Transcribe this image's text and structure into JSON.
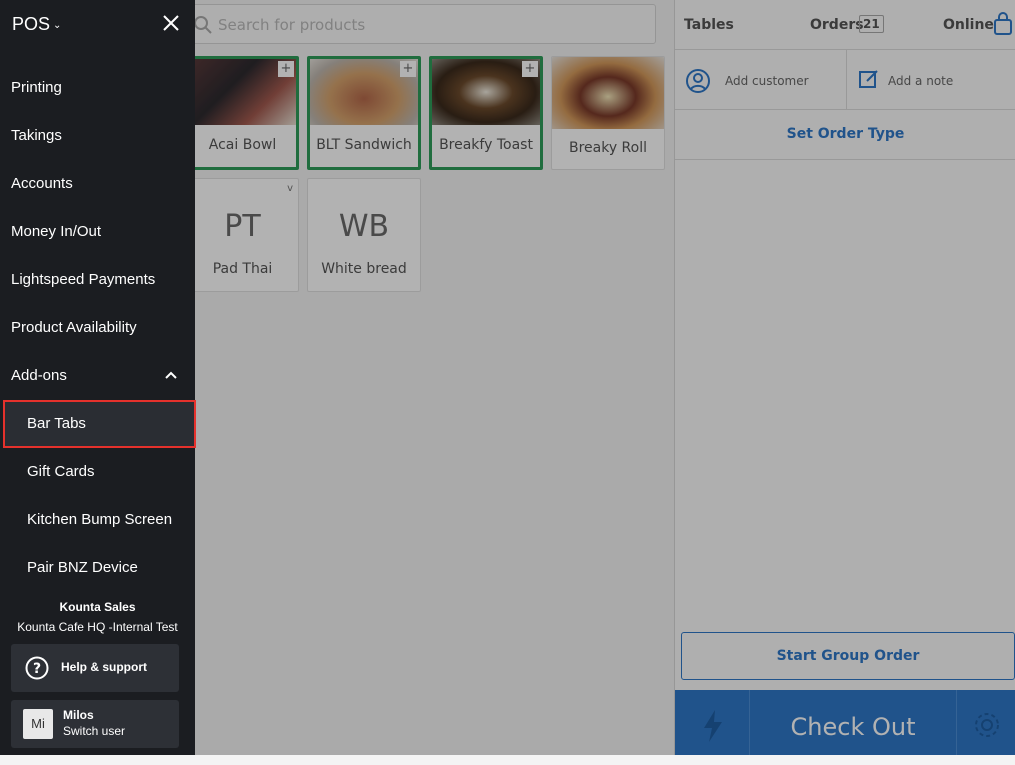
{
  "search": {
    "placeholder": "Search for products"
  },
  "products": [
    {
      "name": "Acai Bowl",
      "selected": true,
      "plus": "+"
    },
    {
      "name": "BLT Sandwich",
      "selected": true,
      "plus": "+"
    },
    {
      "name": "Breakfy Toast",
      "selected": true,
      "plus": "+"
    },
    {
      "name": "Breaky Roll",
      "selected": false
    },
    {
      "name": "Pad Thai",
      "abbr": "PT",
      "chevron": "v"
    },
    {
      "name": "White bread",
      "abbr": "WB"
    }
  ],
  "order": {
    "tables_label": "Tables",
    "orders_label": "Orders",
    "orders_count": "21",
    "online_label": "Online",
    "add_customer": "Add customer",
    "add_note": "Add a note",
    "set_order_type": "Set Order Type",
    "start_group_order": "Start Group Order",
    "checkout": "Check Out"
  },
  "sidebar": {
    "brand": "POS",
    "brand_chevron": "⌄",
    "items": [
      "Printing",
      "Takings",
      "Accounts",
      "Money In/Out",
      "Lightspeed Payments",
      "Product Availability",
      "Add-ons"
    ],
    "subitems": [
      "Bar Tabs",
      "Gift Cards",
      "Kitchen Bump Screen",
      "Pair BNZ Device"
    ],
    "active_item": "Bar Tabs",
    "org_name": "Kounta Sales",
    "site_name": "Kounta Cafe HQ -Internal Test",
    "help_label": "Help & support",
    "user_initials": "Mi",
    "user_name": "Milos",
    "switch_user": "Switch user"
  },
  "colors": {
    "sidebar_bg": "#1b1d21",
    "accent_blue": "#2f78c8",
    "selected_green": "#2f9c59",
    "highlight_red": "#e5312c"
  }
}
